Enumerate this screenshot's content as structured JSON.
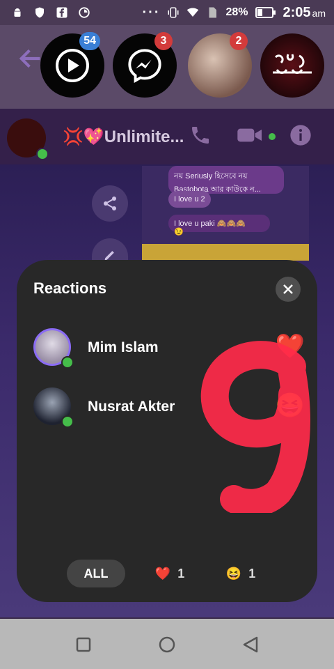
{
  "status_bar": {
    "battery_percent": "28%",
    "time": "2:05",
    "ampm": "am",
    "icons": [
      "android-icon",
      "shield-icon",
      "facebook-icon",
      "timer-icon",
      "more-icon",
      "vibrate-icon",
      "wifi-icon",
      "sim-icon",
      "battery-icon"
    ]
  },
  "chat_heads": [
    {
      "name": "play-head",
      "badge": "54",
      "badge_color": "#3a7fd5"
    },
    {
      "name": "messenger-head",
      "badge": "3",
      "badge_color": "#d33b3b"
    },
    {
      "name": "couple-photo-head",
      "badge": "2",
      "badge_color": "#d33b3b"
    },
    {
      "name": "eid-mubarak-head",
      "badge": ""
    }
  ],
  "chat_header": {
    "title": "💢💖Unlimite...",
    "icons": [
      "phone-icon",
      "video-icon",
      "info-icon"
    ]
  },
  "background_messages": {
    "m1": "নয় Seriusly হিসেবে নয় Bastobota আর কাউকে ন...",
    "m2": "I love u 2",
    "m3": "I love u paki 🙈🙈🙈",
    "m4": "😉"
  },
  "modal": {
    "title": "Reactions",
    "reactions": [
      {
        "name": "Mim Islam",
        "emoji": "❤️"
      },
      {
        "name": "Nusrat Akter",
        "emoji": "😆"
      }
    ],
    "tabs": {
      "all": "ALL",
      "heart_emoji": "❤️",
      "heart_count": "1",
      "laugh_emoji": "😆",
      "laugh_count": "1"
    }
  },
  "colors": {
    "modal_bg": "#282828",
    "online_dot": "#45bd4a",
    "accent_ring": "#8b6cf4",
    "scribble": "#ff2a4a"
  }
}
